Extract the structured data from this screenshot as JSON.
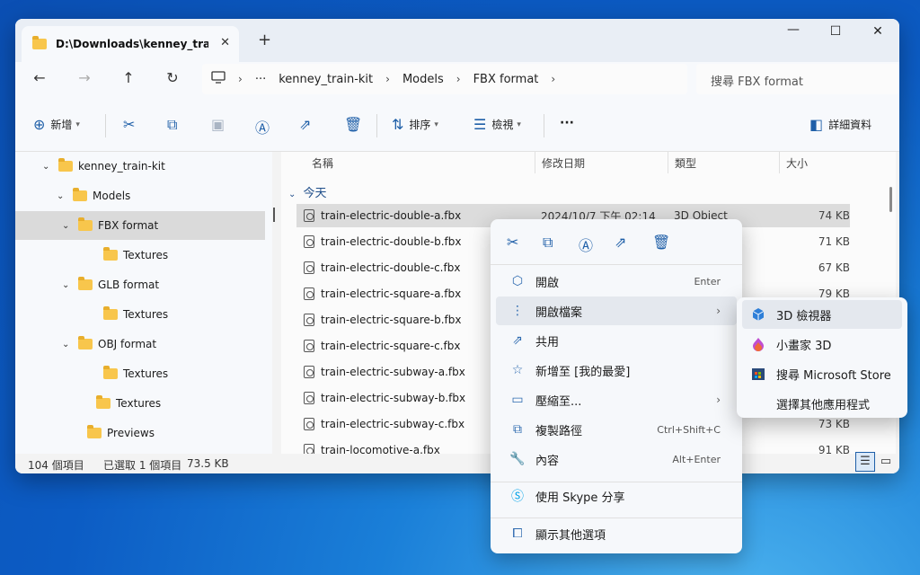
{
  "tab": {
    "title": "D:\\Downloads\\kenney_train-ki",
    "close": "✕",
    "new_tab": "+"
  },
  "window_controls": {
    "minimize": "—",
    "maximize": "☐",
    "close": "✕"
  },
  "nav": {
    "back": "←",
    "forward": "→",
    "up": "↑",
    "refresh": "↻"
  },
  "address": {
    "more": "···",
    "sep": "›",
    "crumbs": [
      "kenney_train-kit",
      "Models",
      "FBX format"
    ]
  },
  "search": {
    "placeholder": "搜尋 FBX format"
  },
  "toolbar": {
    "new_label": "新增",
    "sort_label": "排序",
    "view_label": "檢視",
    "more": "···",
    "details_label": "詳細資料"
  },
  "tree": [
    {
      "label": "kenney_train-kit",
      "expanded": true
    },
    {
      "label": "Models",
      "expanded": true
    },
    {
      "label": "FBX format",
      "expanded": true,
      "selected": true
    },
    {
      "label": "Textures"
    },
    {
      "label": "GLB format",
      "expanded": true
    },
    {
      "label": "Textures"
    },
    {
      "label": "OBJ format",
      "expanded": true
    },
    {
      "label": "Textures"
    },
    {
      "label": "Textures"
    },
    {
      "label": "Previews"
    }
  ],
  "columns": {
    "name": "名稱",
    "date": "修改日期",
    "type": "類型",
    "size": "大小"
  },
  "group_label": "今天",
  "files": [
    {
      "name": "train-electric-double-a.fbx",
      "date": "2024/10/7 下午 02:14",
      "type": "3D Object",
      "size": "74 KB",
      "selected": true
    },
    {
      "name": "train-electric-double-b.fbx",
      "size": "71 KB"
    },
    {
      "name": "train-electric-double-c.fbx",
      "size": "67 KB"
    },
    {
      "name": "train-electric-square-a.fbx",
      "size": "79 KB"
    },
    {
      "name": "train-electric-square-b.fbx",
      "size": ""
    },
    {
      "name": "train-electric-square-c.fbx",
      "size": ""
    },
    {
      "name": "train-electric-subway-a.fbx",
      "size": ""
    },
    {
      "name": "train-electric-subway-b.fbx",
      "size": ""
    },
    {
      "name": "train-electric-subway-c.fbx",
      "size": "73 KB"
    },
    {
      "name": "train-locomotive-a.fbx",
      "size": "91 KB"
    }
  ],
  "status": {
    "count": "104 個項目",
    "selected": "已選取 1 個項目",
    "size": "73.5 KB"
  },
  "context_menu": {
    "items": [
      {
        "label": "開啟",
        "icon": "3d-cube-icon",
        "glyph": "⬡",
        "shortcut": "Enter"
      },
      {
        "label": "開啟檔案",
        "icon": "open-with-icon",
        "glyph": "⋮",
        "submenu": true,
        "hover": true
      },
      {
        "label": "共用",
        "icon": "share-icon",
        "glyph": "⇗"
      },
      {
        "label": "新增至 [我的最愛]",
        "icon": "star-icon",
        "glyph": "☆"
      },
      {
        "label": "壓縮至...",
        "icon": "zip-folder-icon",
        "glyph": "▭",
        "submenu": true
      },
      {
        "label": "複製路徑",
        "icon": "copy-path-icon",
        "glyph": "⧉",
        "shortcut": "Ctrl+Shift+C"
      },
      {
        "label": "內容",
        "icon": "wrench-icon",
        "glyph": "🔧",
        "shortcut": "Alt+Enter"
      }
    ],
    "skype": "使用 Skype 分享",
    "more_options": "顯示其他選項"
  },
  "submenu": {
    "items": [
      {
        "label": "3D 檢視器",
        "icon": "3d-viewer-icon"
      },
      {
        "label": "小畫家 3D",
        "icon": "paint3d-icon"
      },
      {
        "label": "搜尋 Microsoft Store",
        "icon": "store-icon"
      },
      {
        "label": "選擇其他應用程式",
        "icon": ""
      }
    ]
  },
  "colors": {
    "accent": "#1f5fa8",
    "folder": "#f8c64c",
    "selection": "#dcdcdc"
  }
}
